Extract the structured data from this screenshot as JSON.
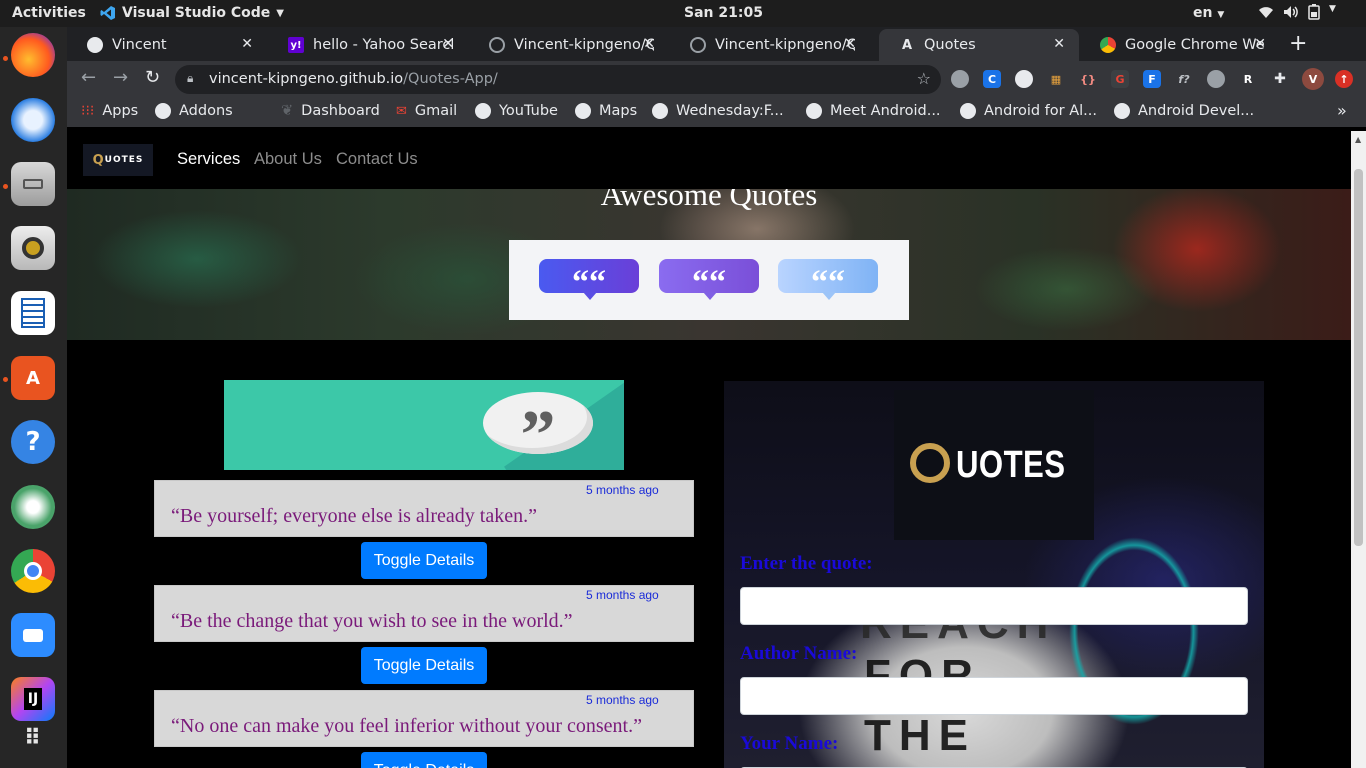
{
  "system": {
    "activities": "Activities",
    "app_name": "Visual Studio Code",
    "clock": "San 21:05",
    "language": "en"
  },
  "browser": {
    "tabs": [
      {
        "title": "Vincent",
        "icon": "globe-icon"
      },
      {
        "title": "hello - Yahoo Search",
        "icon": "yahoo-icon"
      },
      {
        "title": "Vincent-kipngeno/Q",
        "icon": "github-icon"
      },
      {
        "title": "Vincent-kipngeno/Q",
        "icon": "github-icon"
      },
      {
        "title": "Quotes",
        "icon": "angular-icon"
      },
      {
        "title": "Google Chrome Web",
        "icon": "chrome-icon"
      }
    ],
    "url_host": "vincent-kipngeno.github.io",
    "url_path": "/Quotes-App/",
    "bookmarks": [
      {
        "label": "Apps",
        "icon": "apps-grid-icon"
      },
      {
        "label": "Addons",
        "icon": "globe-icon"
      },
      {
        "label": "Dashboard",
        "icon": "leaf-icon"
      },
      {
        "label": "Gmail",
        "icon": "gmail-icon"
      },
      {
        "label": "YouTube",
        "icon": "globe-icon"
      },
      {
        "label": "Maps",
        "icon": "globe-icon"
      },
      {
        "label": "Wednesday:F...",
        "icon": "globe-icon"
      },
      {
        "label": "Meet Android...",
        "icon": "globe-icon"
      },
      {
        "label": "Android for Al...",
        "icon": "globe-icon"
      },
      {
        "label": "Android Devel...",
        "icon": "globe-icon"
      }
    ],
    "profile_initial": "V"
  },
  "page": {
    "logo_text": "UOTES",
    "nav": [
      {
        "label": "Services",
        "active": true
      },
      {
        "label": "About Us",
        "active": false
      },
      {
        "label": "Contact Us",
        "active": false
      }
    ],
    "hero_title": "Awesome Quotes",
    "quotes": [
      {
        "time": "5 months ago",
        "text": "“Be yourself; everyone else is already taken.”"
      },
      {
        "time": "5 months ago",
        "text": "“Be the change that you wish to see in the world.”"
      },
      {
        "time": "5 months ago",
        "text": "“No one can make you feel inferior without your consent.”"
      }
    ],
    "toggle_label": "Toggle Details",
    "form": {
      "logo_text": "UOTES",
      "quote_label": "Enter the quote:",
      "author_label": "Author Name:",
      "your_name_label": "Your Name:",
      "background_text": [
        "REACH",
        "FOR",
        "THE"
      ]
    }
  },
  "colors": {
    "primary_button": "#007bff",
    "quote_text": "#7a1a7a",
    "time_text": "#1a2bd8",
    "form_label": "#1a0ad8",
    "banner_teal": "#3cc8a8"
  }
}
